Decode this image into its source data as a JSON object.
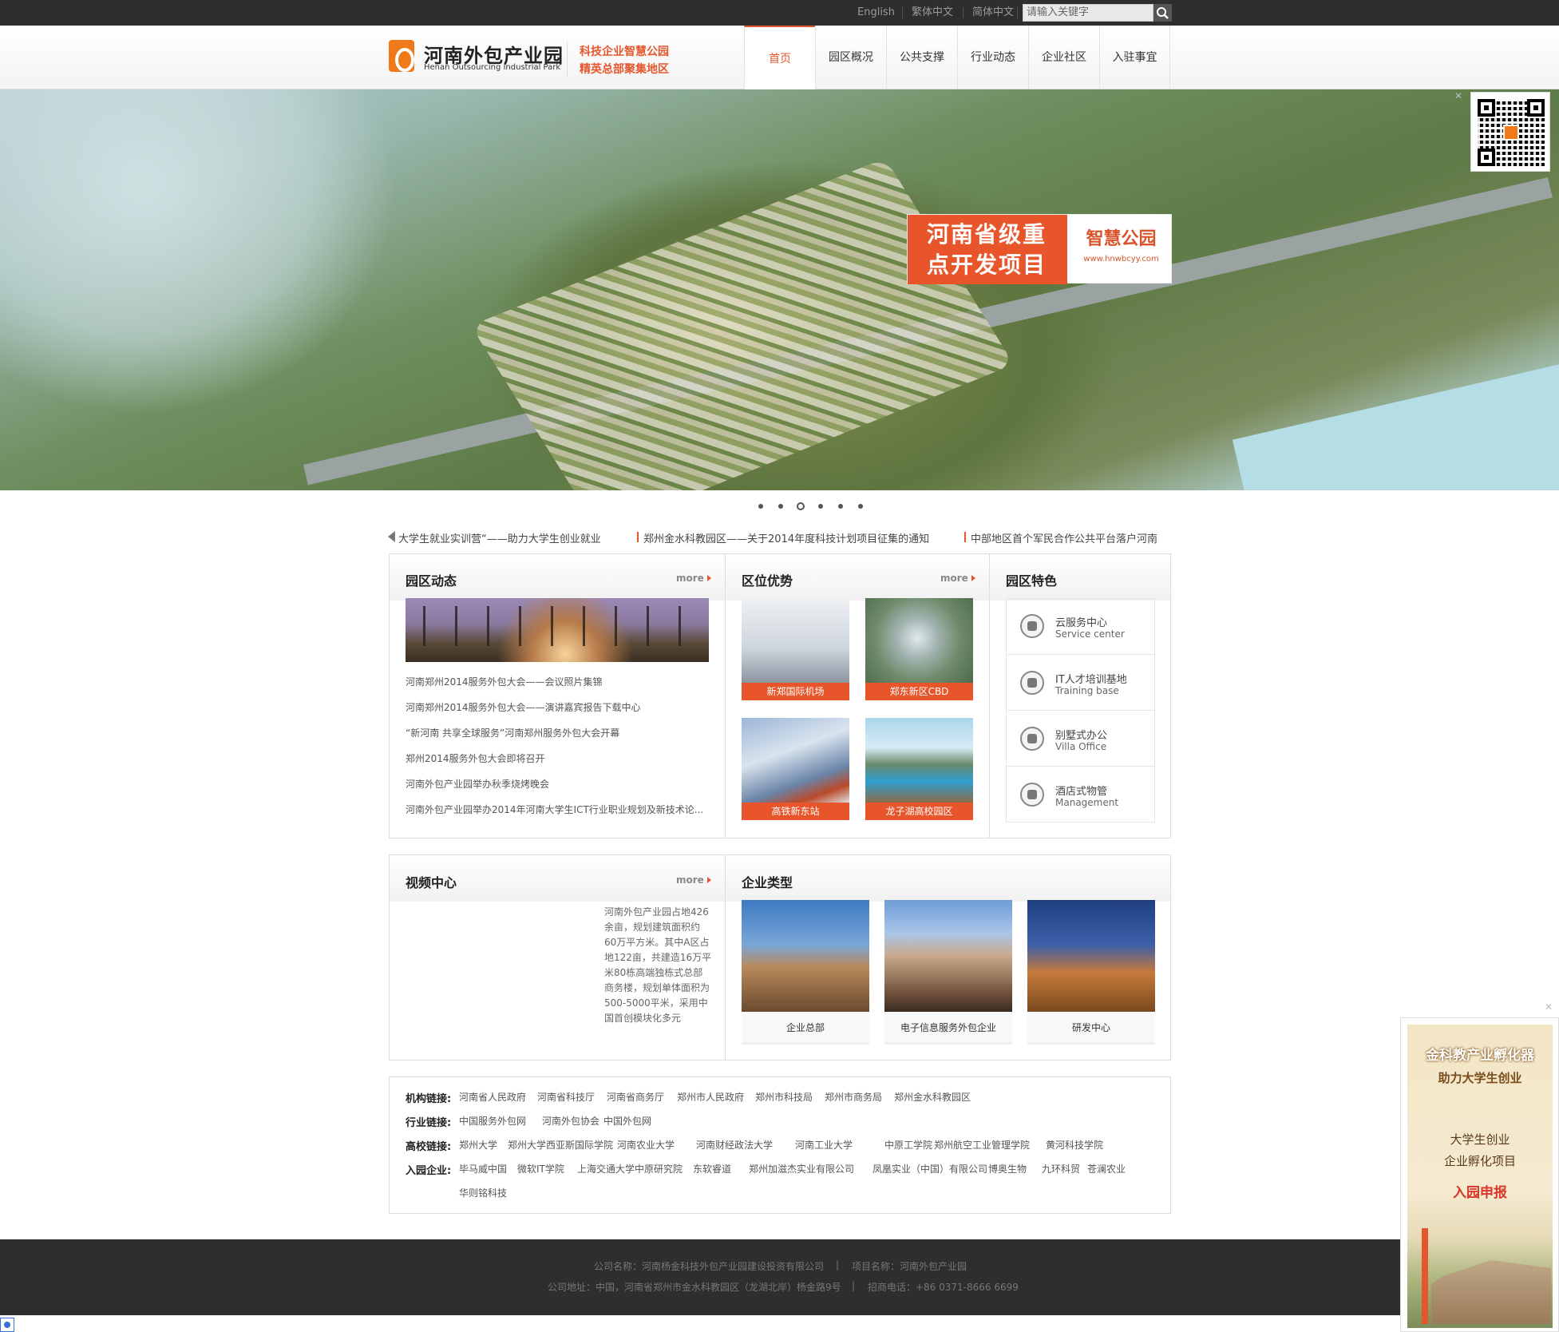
{
  "topbar": {
    "languages": [
      "English",
      "繁体中文",
      "简体中文"
    ],
    "search_placeholder": "请输入关键字"
  },
  "header": {
    "logo_cn": "河南外包产业园",
    "logo_en": "Henan Outsourcing Industrial Park",
    "slogan_line1": "科技企业智慧公园",
    "slogan_line2": "精英总部聚集地区"
  },
  "nav": {
    "items": [
      "首页",
      "园区概况",
      "公共支撑",
      "行业动态",
      "企业社区",
      "入驻事宜"
    ],
    "active_index": 0
  },
  "banner": {
    "promo_title": "河南省级重点开发项目",
    "promo_line1": "河南省级重",
    "promo_line2": "点开发项目",
    "promo_brand": "智慧公园",
    "promo_url": "www.hnwbcyy.com",
    "slide_count": 6,
    "active_slide": 2
  },
  "ticker": {
    "items": [
      "大学生就业实训营“——助力大学生创业就业",
      "郑州金水科教园区——关于2014年度科技计划项目征集的通知",
      "中部地区首个军民合作公共平台落户河南"
    ]
  },
  "park_news": {
    "title": "园区动态",
    "more": "more",
    "items": [
      "河南郑州2014服务外包大会——会议照片集锦",
      "河南郑州2014服务外包大会——演讲嘉宾报告下载中心",
      "“新河南 共享全球服务”河南郑州服务外包大会开幕",
      "郑州2014服务外包大会即将召开",
      "河南外包产业园举办秋季烧烤晚会",
      "河南外包产业园举办2014年河南大学生ICT行业职业规划及新技术论..."
    ]
  },
  "location": {
    "title": "区位优势",
    "more": "more",
    "items": [
      "新郑国际机场",
      "郑东新区CBD",
      "高铁新东站",
      "龙子湖高校园区"
    ]
  },
  "features": {
    "title": "园区特色",
    "items": [
      {
        "cn": "云服务中心",
        "en": "Service center",
        "icon": "cloud-icon"
      },
      {
        "cn": "IT人才培训基地",
        "en": "Training base",
        "icon": "person-icon"
      },
      {
        "cn": "别墅式办公",
        "en": "Villa Office",
        "icon": "monitor-icon"
      },
      {
        "cn": "酒店式物管",
        "en": "Management",
        "icon": "building-icon"
      }
    ]
  },
  "video": {
    "title": "视频中心",
    "more": "more",
    "description": "河南外包产业园占地426余亩，规划建筑面积约60万平方米。其中A区占地122亩，共建造16万平米80栋高端独栋式总部商务楼，规划单体面积为500-5000平米，采用中国首创模块化多元"
  },
  "enterprise_types": {
    "title": "企业类型",
    "items": [
      "企业总部",
      "电子信息服务外包企业",
      "研发中心"
    ]
  },
  "links": {
    "rows": [
      {
        "label": "机构链接:",
        "items": [
          "河南省人民政府",
          "河南省科技厅",
          "河南省商务厅",
          "郑州市人民政府",
          "郑州市科技局",
          "郑州市商务局",
          "郑州金水科教园区"
        ]
      },
      {
        "label": "行业链接:",
        "items": [
          "中国服务外包网",
          "河南外包协会",
          "中国外包网"
        ]
      },
      {
        "label": "高校链接:",
        "items": [
          "郑州大学",
          "郑州大学西亚斯国际学院",
          "河南农业大学",
          "河南财经政法大学",
          "河南工业大学",
          "中原工学院",
          "郑州航空工业管理学院",
          "黄河科技学院"
        ]
      },
      {
        "label": "入园企业:",
        "items": [
          "毕马威中国",
          "微软IT学院",
          "上海交通大学中原研究院",
          "东软睿道",
          "郑州加滋杰实业有限公司",
          "凤凰实业（中国）有限公司",
          "博奥生物",
          "九环科贸",
          "苍澜农业",
          "华则铭科技"
        ]
      }
    ]
  },
  "footer": {
    "line1_company": "公司名称：河南杨金科技外包产业园建设投资有限公司",
    "line1_project": "项目名称：河南外包产业园",
    "line2_address": "公司地址：中国，河南省郑州市金水科教园区（龙湖北岸）杨金路9号",
    "line2_phone": "招商电话：+86 0371-8666 6699",
    "separator": "|"
  },
  "side_ad": {
    "title": "金科教产业孵化器",
    "subtitle": "助力大学生创业",
    "line1": "大学生创业",
    "line2": "企业孵化项目",
    "cta": "入园申报"
  },
  "colors": {
    "accent": "#e4572e",
    "topbar": "#2e2e2e",
    "footer": "#2e2e2e"
  }
}
